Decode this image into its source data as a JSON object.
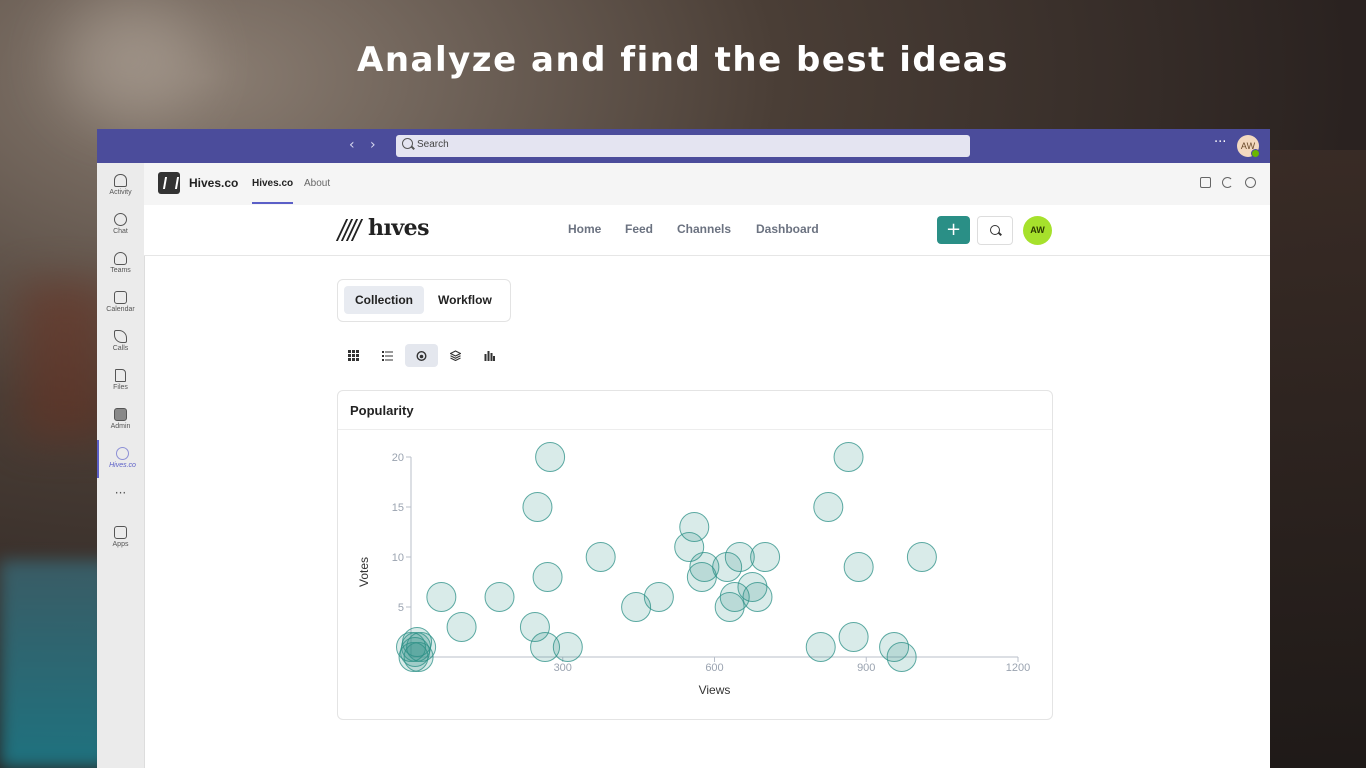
{
  "headline": "Analyze and find the best ideas",
  "teams": {
    "search_placeholder": "Search",
    "more_label": "···",
    "user_initials": "AW",
    "rail": [
      {
        "label": "Activity",
        "icon": "bell-icon"
      },
      {
        "label": "Chat",
        "icon": "chat-icon"
      },
      {
        "label": "Teams",
        "icon": "teams-icon"
      },
      {
        "label": "Calendar",
        "icon": "calendar-icon"
      },
      {
        "label": "Calls",
        "icon": "phone-icon"
      },
      {
        "label": "Files",
        "icon": "file-icon"
      },
      {
        "label": "Admin",
        "icon": "admin-icon"
      },
      {
        "label": "Hives.co",
        "icon": "hives-icon"
      },
      {
        "label": "Apps",
        "icon": "apps-icon"
      }
    ],
    "rail_more": "···"
  },
  "app_header": {
    "app_name": "Hives.co",
    "tabs": [
      "Hives.co",
      "About"
    ]
  },
  "hives_nav": {
    "brand": "hıves",
    "links": [
      "Home",
      "Feed",
      "Channels",
      "Dashboard"
    ],
    "add_label": "+",
    "user_initials": "AW"
  },
  "segments": [
    "Collection",
    "Workflow"
  ],
  "card": {
    "title": "Popularity"
  },
  "chart_data": {
    "type": "scatter",
    "xlabel": "Views",
    "ylabel": "Votes",
    "xlim": [
      0,
      1200
    ],
    "ylim": [
      0,
      20
    ],
    "x_ticks": [
      300,
      600,
      900,
      1200
    ],
    "y_ticks": [
      5,
      10,
      15,
      20
    ],
    "color": "#2a8f86",
    "points": [
      [
        0,
        1
      ],
      [
        5,
        0
      ],
      [
        10,
        1
      ],
      [
        15,
        0
      ],
      [
        20,
        1
      ],
      [
        8,
        0.5
      ],
      [
        12,
        1.5
      ],
      [
        60,
        6
      ],
      [
        100,
        3
      ],
      [
        175,
        6
      ],
      [
        245,
        3
      ],
      [
        250,
        15
      ],
      [
        265,
        1
      ],
      [
        270,
        8
      ],
      [
        275,
        20
      ],
      [
        310,
        1
      ],
      [
        375,
        10
      ],
      [
        445,
        5
      ],
      [
        490,
        6
      ],
      [
        550,
        11
      ],
      [
        560,
        13
      ],
      [
        575,
        8
      ],
      [
        580,
        9
      ],
      [
        625,
        9
      ],
      [
        630,
        5
      ],
      [
        640,
        6
      ],
      [
        650,
        10
      ],
      [
        675,
        7
      ],
      [
        685,
        6
      ],
      [
        700,
        10
      ],
      [
        810,
        1
      ],
      [
        825,
        15
      ],
      [
        865,
        20
      ],
      [
        875,
        2
      ],
      [
        885,
        9
      ],
      [
        955,
        1
      ],
      [
        970,
        0
      ],
      [
        1010,
        10
      ]
    ]
  }
}
